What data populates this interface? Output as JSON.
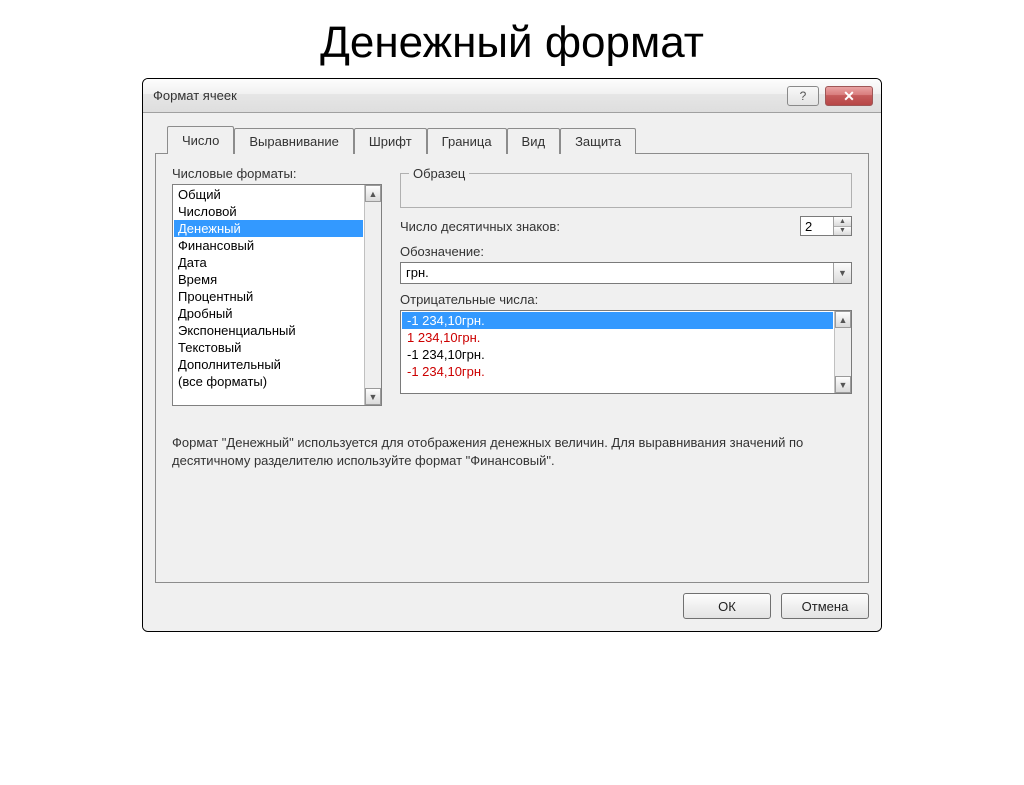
{
  "page_heading": "Денежный формат",
  "titlebar": {
    "title": "Формат ячеек",
    "help": "?",
    "close": "✕"
  },
  "tabs": [
    "Число",
    "Выравнивание",
    "Шрифт",
    "Граница",
    "Вид",
    "Защита"
  ],
  "active_tab_index": 0,
  "left": {
    "label": "Числовые форматы:",
    "items": [
      "Общий",
      "Числовой",
      "Денежный",
      "Финансовый",
      "Дата",
      "Время",
      "Процентный",
      "Дробный",
      "Экспоненциальный",
      "Текстовый",
      "Дополнительный",
      "(все форматы)"
    ],
    "selected_index": 2
  },
  "sample_legend": "Образец",
  "decimals": {
    "label": "Число десятичных знаков:",
    "value": "2"
  },
  "symbol": {
    "label": "Обозначение:",
    "value": "грн."
  },
  "negatives": {
    "label": "Отрицательные числа:",
    "items": [
      {
        "text": "-1 234,10грн.",
        "color": "black",
        "selected": true
      },
      {
        "text": "1 234,10грн.",
        "color": "red",
        "selected": false
      },
      {
        "text": "-1 234,10грн.",
        "color": "black",
        "selected": false
      },
      {
        "text": "-1 234,10грн.",
        "color": "red",
        "selected": false
      }
    ]
  },
  "help_text": "Формат \"Денежный\" используется для отображения денежных величин. Для выравнивания значений по десятичному разделителю используйте формат \"Финансовый\".",
  "buttons": {
    "ok": "ОК",
    "cancel": "Отмена"
  }
}
